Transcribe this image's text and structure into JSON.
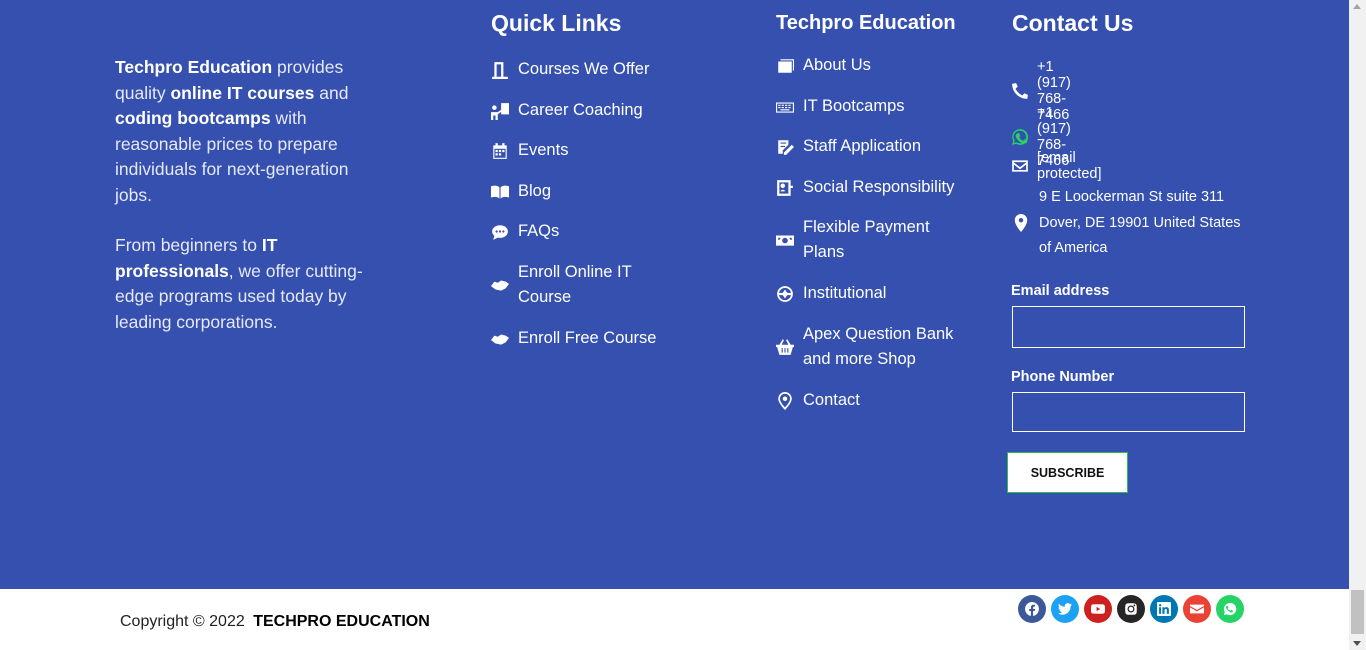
{
  "about": {
    "p1": [
      {
        "t": "Techpro Education",
        "b": true
      },
      {
        "t": " provides quality ",
        "b": false
      },
      {
        "t": "online IT courses",
        "b": true
      },
      {
        "t": " and ",
        "b": false
      },
      {
        "t": "coding bootcamps",
        "b": true
      },
      {
        "t": "  with reasonable prices to prepare individuals for next-generation jobs.",
        "b": false
      }
    ],
    "p2": [
      {
        "t": "From beginners to ",
        "b": false
      },
      {
        "t": "IT professionals",
        "b": true
      },
      {
        "t": ", we offer cutting-edge programs used today by leading corporations.",
        "b": false
      }
    ]
  },
  "quick_links": {
    "title": "Quick Links",
    "items": [
      {
        "label": "Courses We Offer",
        "icon": "door-icon"
      },
      {
        "label": "Career Coaching",
        "icon": "coaching-icon"
      },
      {
        "label": "Events",
        "icon": "calendar-icon"
      },
      {
        "label": "Blog",
        "icon": "book-icon"
      },
      {
        "label": "FAQs",
        "icon": "chat-icon"
      },
      {
        "label": "Enroll Online IT Course",
        "icon": "handshake-icon"
      },
      {
        "label": "Enroll Free Course",
        "icon": "handshake-icon"
      }
    ]
  },
  "techpro": {
    "title": "Techpro Education",
    "items": [
      {
        "label": "About Us",
        "icon": "images-icon"
      },
      {
        "label": "IT Bootcamps",
        "icon": "keyboard-icon"
      },
      {
        "label": "Staff Application",
        "icon": "edit-icon"
      },
      {
        "label": "Social Responsibility",
        "icon": "user-badge-icon"
      },
      {
        "label": "Flexible Payment Plans",
        "icon": "money-icon"
      },
      {
        "label": "Institutional",
        "icon": "globe-icon"
      },
      {
        "label": "Apex Question Bank and more Shop",
        "icon": "basket-icon"
      },
      {
        "label": "Contact",
        "icon": "map-pin-icon"
      }
    ]
  },
  "contact": {
    "title": "Contact Us",
    "phone": "+1 (917) 768-7466",
    "whatsapp": "+1 (917) 768-7466",
    "email": "[email protected]",
    "address": "9 E Loockerman St suite 311 Dover, DE 19901 United States of America"
  },
  "form": {
    "email_label": "Email address",
    "email_value": "",
    "phone_label": "Phone Number",
    "phone_value": "",
    "submit_label": "SUBSCRIBE"
  },
  "copyright": {
    "prefix": "Copyright © 2022",
    "brand": "TECHPRO EDUCATION"
  },
  "socials": [
    {
      "name": "facebook-icon",
      "color": "#3b5998"
    },
    {
      "name": "twitter-icon",
      "color": "#1da1f2"
    },
    {
      "name": "youtube-icon",
      "color": "#cd201f"
    },
    {
      "name": "instagram-icon",
      "color": "#262626"
    },
    {
      "name": "linkedin-icon",
      "color": "#0077b5"
    },
    {
      "name": "envelope-icon",
      "color": "#ea4335"
    },
    {
      "name": "whatsapp-icon",
      "color": "#25d366"
    }
  ],
  "colors": {
    "footer_bg": "#3550ae",
    "whatsapp_green": "#25d366"
  }
}
